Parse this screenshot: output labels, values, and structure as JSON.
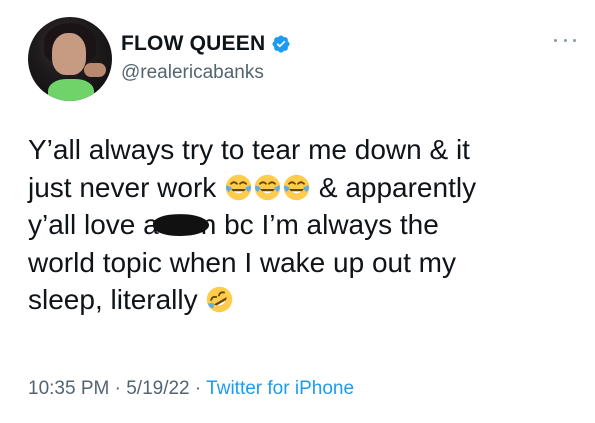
{
  "user": {
    "display_name": "FLOW QUEEN",
    "handle": "@realericabanks",
    "verified": true,
    "avatar_icon": "profile-photo"
  },
  "tweet": {
    "line1": "Y’all always try to tear me down & it",
    "line2_a": "just never work",
    "line2_b": "& apparently",
    "line3_a": "y’all love a",
    "line3_b": "n bc I’m always the",
    "line4": "world topic when I wake up out my",
    "line5": "sleep, literally",
    "emojis": [
      "face-with-tears-of-joy-icon",
      "face-with-tears-of-joy-icon",
      "face-with-tears-of-joy-icon",
      "rolling-on-floor-laughing-icon"
    ],
    "redaction": "censored-word"
  },
  "meta": {
    "time": "10:35 PM",
    "sep1": " · ",
    "date": "5/19/22",
    "sep2": " · ",
    "source": "Twitter for iPhone"
  },
  "colors": {
    "text": "#0f1419",
    "secondary": "#536471",
    "accent": "#1d9bf0",
    "verified": "#1d9bf0"
  }
}
